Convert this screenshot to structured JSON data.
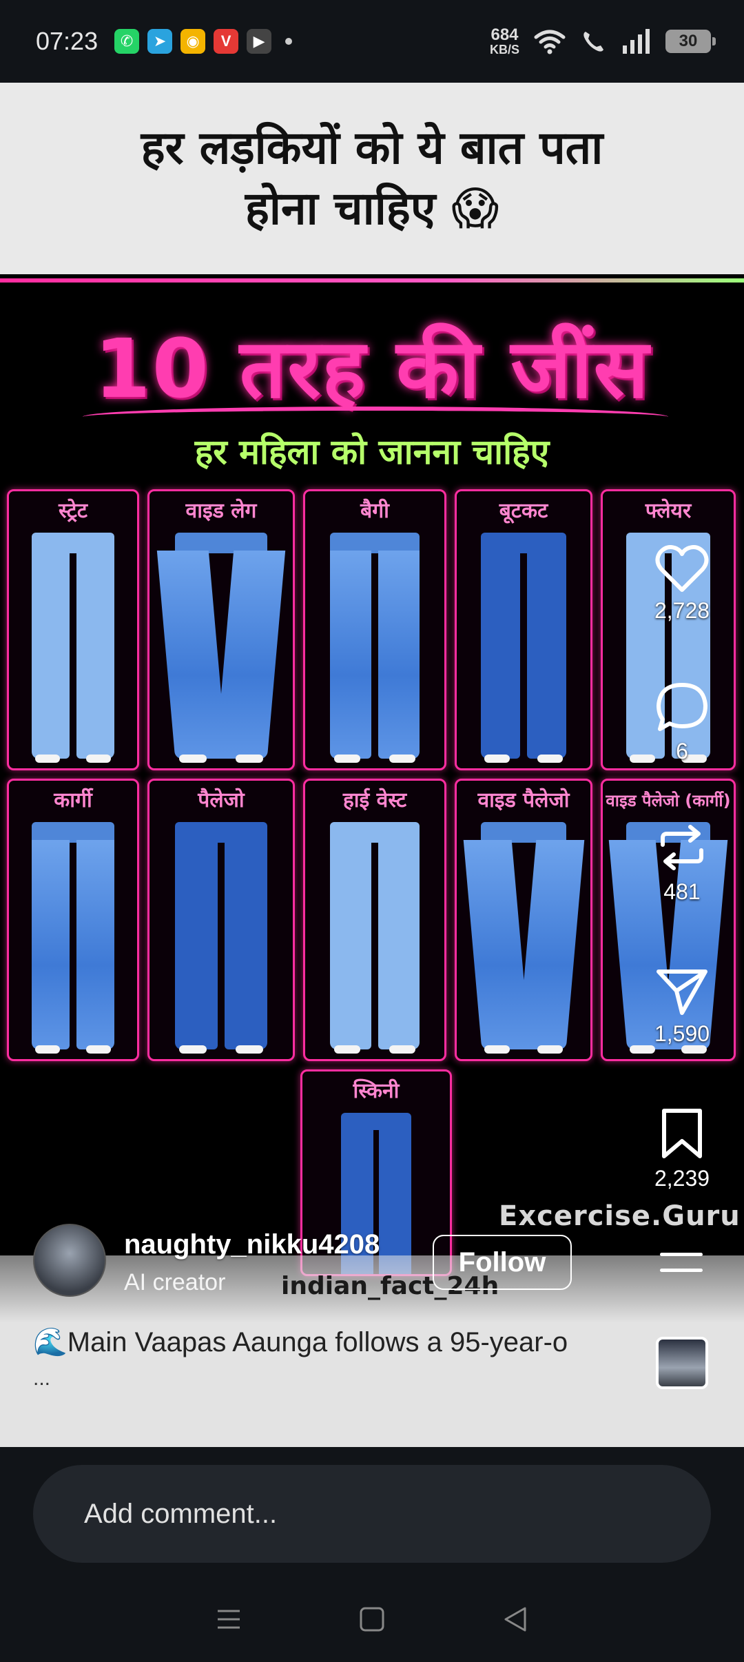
{
  "status_bar": {
    "time": "07:23",
    "net_speed_value": "684",
    "net_speed_unit": "KB/S",
    "battery": "30",
    "apps": [
      {
        "icon": "whatsapp-icon",
        "glyph": "✆",
        "color": "#25d366"
      },
      {
        "icon": "telegram-icon",
        "glyph": "➤",
        "color": "#2aa3de"
      },
      {
        "icon": "app-ring-icon",
        "glyph": "◉",
        "color": "#f4b400"
      },
      {
        "icon": "vpn-icon",
        "glyph": "V",
        "color": "#e53935"
      },
      {
        "icon": "youtube-icon",
        "glyph": "▶",
        "color": "#444444"
      }
    ]
  },
  "post": {
    "header_line1": "हर लड़कियों को ये बात पता",
    "header_line2": "होना चाहिए 😱",
    "title": "10 तरह की जींस",
    "subtitle": "हर महिला को जानना चाहिए",
    "jeans_types": [
      "स्ट्रेट",
      "वाइड लेग",
      "बैगी",
      "बूटकट",
      "फ्लेयर",
      "कार्गी",
      "पैलेजो",
      "हाई वेस्ट",
      "वाइड पैलेजो",
      "वाइड पैलेजो (कार्गी)",
      "स्किनी"
    ],
    "watermark": "Excercise.Guru"
  },
  "actions": {
    "likes": "2,728",
    "comments": "6",
    "reposts": "481",
    "shares": "1,590",
    "saves": "2,239"
  },
  "author": {
    "username": "naughty_nikku4208",
    "subtitle": "AI creator",
    "follow_label": "Follow",
    "overlay_text": "indian_fact_24h"
  },
  "caption": {
    "text": "🌊Main Vaapas Aaunga follows a 95-year-o",
    "more": "..."
  },
  "comment": {
    "placeholder": "Add comment..."
  },
  "colors": {
    "accent_pink": "#ff2da0",
    "accent_green": "#b6ff6a"
  }
}
